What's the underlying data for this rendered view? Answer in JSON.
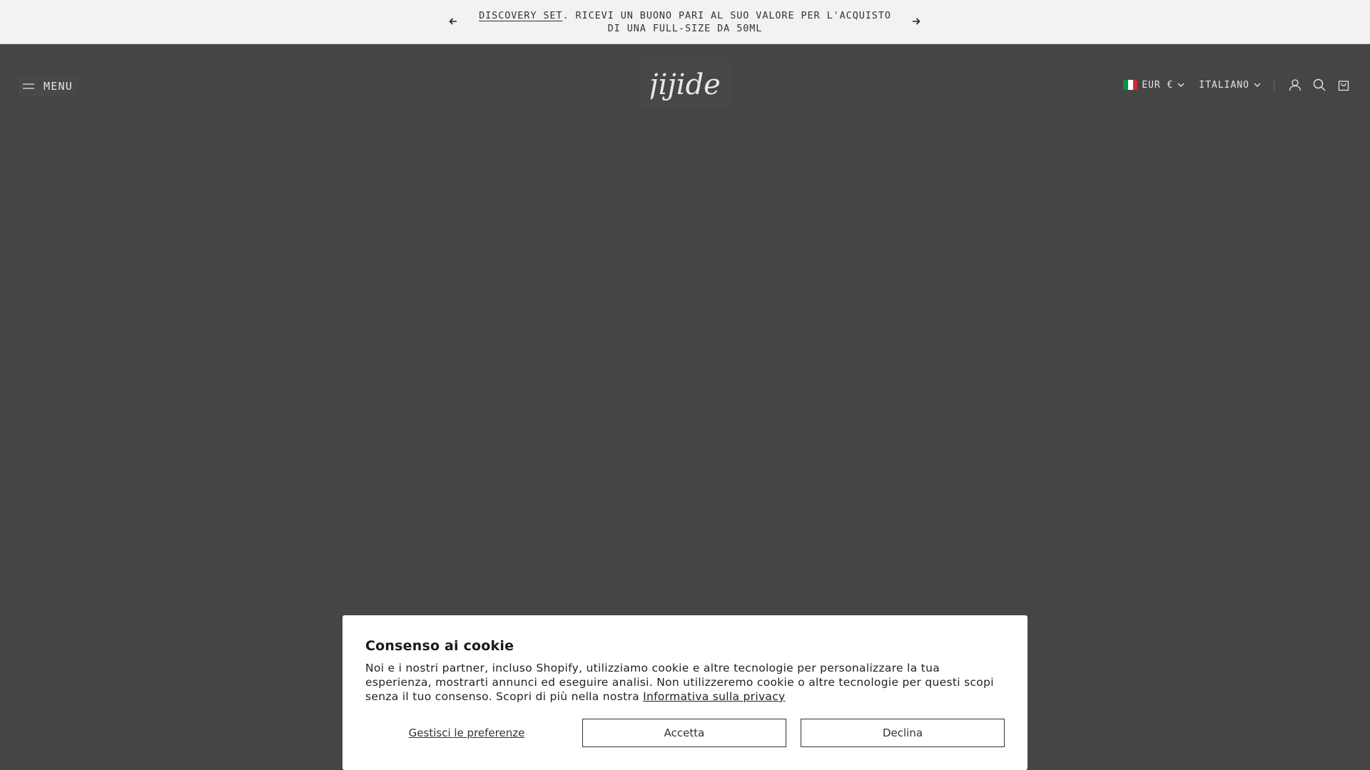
{
  "announcement": {
    "link_text": "DISCOVERY SET",
    "rest_text": ". RICEVI UN BUONO PARI AL SUO VALORE PER L'ACQUISTO DI UNA FULL-SIZE DA 50ML"
  },
  "header": {
    "menu_label": "MENU",
    "logo_text": "jijide",
    "currency_label": "EUR €",
    "language_label": "ITALIANO",
    "flag_colors": [
      "#009246",
      "#ffffff",
      "#ce2b37"
    ]
  },
  "cookie": {
    "title": "Consenso ai cookie",
    "body": "Noi e i nostri partner, incluso Shopify, utilizziamo cookie e altre tecnologie per personalizzare la tua esperienza, mostrarti annunci ed eseguire analisi. Non utilizzeremo cookie o altre tecnologie per questi scopi senza il tuo consenso. Scopri di più nella nostra ",
    "privacy_link": "Informativa sulla privacy",
    "manage_label": "Gestisci le preferenze",
    "accept_label": "Accetta",
    "decline_label": "Declina"
  },
  "colors": {
    "overlay": "#454545",
    "announcement_bg": "#f2f2f0",
    "modal_bg": "#ffffff"
  }
}
